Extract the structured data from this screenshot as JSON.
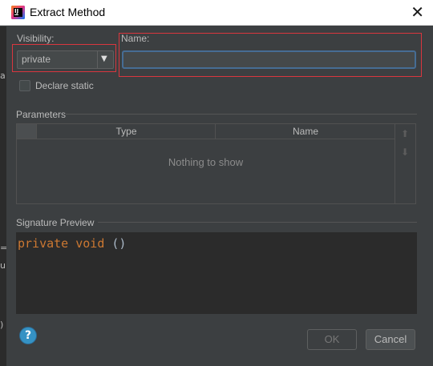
{
  "window": {
    "title": "Extract Method",
    "close_glyph": "✕",
    "app_icon": "intellij-idea-icon"
  },
  "left_strip": {
    "glyphs": [
      "a",
      "=",
      "u",
      ")"
    ]
  },
  "visibility": {
    "label": "Visibility:",
    "selected": "private",
    "arrow": "▼"
  },
  "name": {
    "label": "Name:",
    "value": ""
  },
  "declare_static": {
    "label": "Declare static",
    "checked": false
  },
  "parameters": {
    "label": "Parameters",
    "columns": [
      "Type",
      "Name"
    ],
    "empty_text": "Nothing to show",
    "move_up": "⬆",
    "move_down": "⬇"
  },
  "signature_preview": {
    "label": "Signature Preview",
    "code": {
      "kw1": "private",
      "kw2": "void",
      "rest": "()"
    }
  },
  "help": {
    "glyph": "?"
  },
  "buttons": {
    "ok": "OK",
    "cancel": "Cancel"
  },
  "colors": {
    "accent_focus": "#466d94",
    "highlight_red": "#d9363e",
    "keyword": "#cc7832"
  }
}
